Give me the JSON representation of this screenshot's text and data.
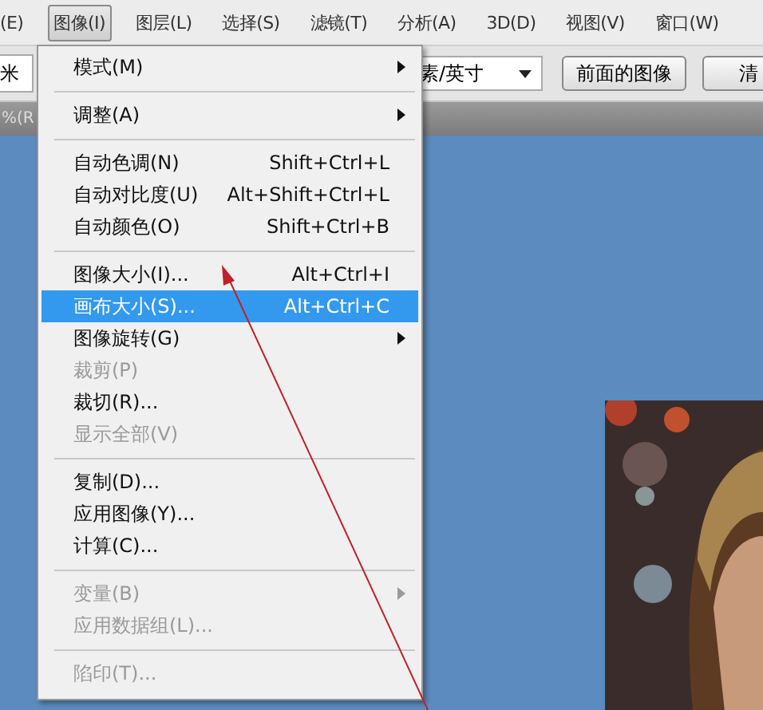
{
  "menubar": [
    {
      "label": "(E)",
      "selected": false
    },
    {
      "label": "图像(I)",
      "selected": true
    },
    {
      "label": "图层(L)",
      "selected": false
    },
    {
      "label": "选择(S)",
      "selected": false
    },
    {
      "label": "滤镜(T)",
      "selected": false
    },
    {
      "label": "分析(A)",
      "selected": false
    },
    {
      "label": "3D(D)",
      "selected": false
    },
    {
      "label": "视图(V)",
      "selected": false
    },
    {
      "label": "窗口(W)",
      "selected": false
    }
  ],
  "options_bar": {
    "field_value": "米",
    "dropdown_value": "素/英寸",
    "buttons": [
      "前面的图像",
      "清"
    ]
  },
  "document_tab": {
    "label": "%(R"
  },
  "menu": {
    "items": [
      {
        "kind": "item",
        "label": "模式(M)",
        "submenu": true,
        "disabled": false,
        "selected": false
      },
      {
        "kind": "separator"
      },
      {
        "kind": "item",
        "label": "调整(A)",
        "submenu": true,
        "disabled": false,
        "selected": false
      },
      {
        "kind": "separator"
      },
      {
        "kind": "item",
        "label": "自动色调(N)",
        "shortcut": "Shift+Ctrl+L",
        "submenu": false,
        "disabled": false,
        "selected": false
      },
      {
        "kind": "item",
        "label": "自动对比度(U)",
        "shortcut": "Alt+Shift+Ctrl+L",
        "submenu": false,
        "disabled": false,
        "selected": false
      },
      {
        "kind": "item",
        "label": "自动颜色(O)",
        "shortcut": "Shift+Ctrl+B",
        "submenu": false,
        "disabled": false,
        "selected": false
      },
      {
        "kind": "separator"
      },
      {
        "kind": "item",
        "label": "图像大小(I)...",
        "shortcut": "Alt+Ctrl+I",
        "submenu": false,
        "disabled": false,
        "selected": false
      },
      {
        "kind": "item",
        "label": "画布大小(S)...",
        "shortcut": "Alt+Ctrl+C",
        "submenu": false,
        "disabled": false,
        "selected": true
      },
      {
        "kind": "item",
        "label": "图像旋转(G)",
        "submenu": true,
        "disabled": false,
        "selected": false
      },
      {
        "kind": "item",
        "label": "裁剪(P)",
        "submenu": false,
        "disabled": true,
        "selected": false
      },
      {
        "kind": "item",
        "label": "裁切(R)...",
        "submenu": false,
        "disabled": false,
        "selected": false
      },
      {
        "kind": "item",
        "label": "显示全部(V)",
        "submenu": false,
        "disabled": true,
        "selected": false
      },
      {
        "kind": "separator"
      },
      {
        "kind": "item",
        "label": "复制(D)...",
        "submenu": false,
        "disabled": false,
        "selected": false
      },
      {
        "kind": "item",
        "label": "应用图像(Y)...",
        "submenu": false,
        "disabled": false,
        "selected": false
      },
      {
        "kind": "item",
        "label": "计算(C)...",
        "submenu": false,
        "disabled": false,
        "selected": false
      },
      {
        "kind": "separator"
      },
      {
        "kind": "item",
        "label": "变量(B)",
        "submenu": true,
        "disabled": true,
        "selected": false
      },
      {
        "kind": "item",
        "label": "应用数据组(L)...",
        "submenu": false,
        "disabled": true,
        "selected": false
      },
      {
        "kind": "separator"
      },
      {
        "kind": "item",
        "label": "陷印(T)...",
        "submenu": false,
        "disabled": true,
        "selected": false
      }
    ]
  }
}
